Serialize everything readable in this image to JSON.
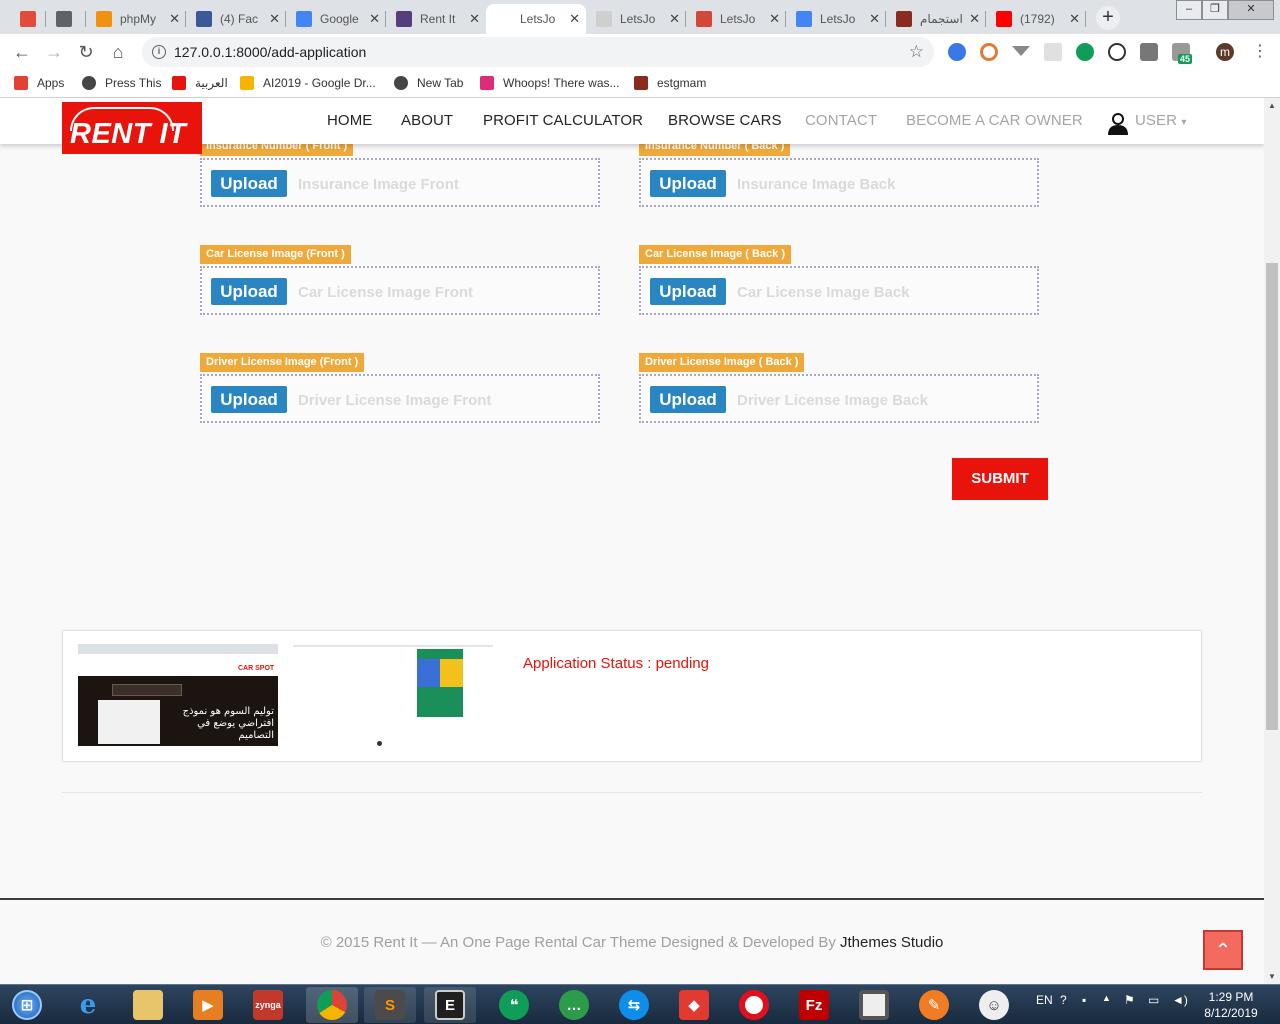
{
  "browser": {
    "tabs": [
      {
        "icon": "u-icon",
        "label": "",
        "color": "#e04b3b"
      },
      {
        "icon": "play-icon",
        "label": "",
        "color": "#5f6368"
      },
      {
        "icon": "pma-icon",
        "label": "phpMy",
        "color": "#f29111"
      },
      {
        "icon": "facebook-icon",
        "label": "(4) Fac",
        "color": "#3b5998"
      },
      {
        "icon": "google-translate-icon",
        "label": "Google",
        "color": "#4285f4"
      },
      {
        "icon": "bootstrap-icon",
        "label": "Rent It",
        "color": "#563d7c"
      },
      {
        "icon": "blank-icon",
        "label": "LetsJo",
        "color": "#ffffff"
      },
      {
        "icon": "doc-icon",
        "label": "LetsJo",
        "color": "#cfcfcf"
      },
      {
        "icon": "gmail-icon",
        "label": "LetsJo",
        "color": "#d44638"
      },
      {
        "icon": "docs-icon",
        "label": "LetsJo",
        "color": "#4285f4"
      },
      {
        "icon": "car-icon",
        "label": "استجمام",
        "color": "#8b2a1e"
      },
      {
        "icon": "youtube-icon",
        "label": "(1792)",
        "color": "#ff0000"
      }
    ],
    "url": "127.0.0.1:8000/add-application",
    "profile_initial": "m",
    "extension_badge": "45",
    "bookmarks": [
      {
        "label": "Apps",
        "icon": "apps-grid-icon",
        "color": "#e44134"
      },
      {
        "label": "Press This",
        "icon": "wordpress-icon",
        "color": "#464646"
      },
      {
        "label": "العربية",
        "icon": "arabic-icon",
        "color": "#e8130b"
      },
      {
        "label": "AI2019 - Google Dr...",
        "icon": "drive-icon",
        "color": "#f4b400"
      },
      {
        "label": "New Tab",
        "icon": "globe-icon",
        "color": "#464646"
      },
      {
        "label": "Whoops! There was...",
        "icon": "whoops-icon",
        "color": "#e02a7a"
      },
      {
        "label": "estgmam",
        "icon": "car-icon",
        "color": "#8b2a1e"
      }
    ]
  },
  "site": {
    "logo": "RENT IT",
    "nav": [
      {
        "label": "HOME",
        "muted": false
      },
      {
        "label": "ABOUT",
        "muted": false
      },
      {
        "label": "PROFIT CALCULATOR",
        "muted": false
      },
      {
        "label": "BROWSE CARS",
        "muted": false
      },
      {
        "label": "CONTACT",
        "muted": true
      },
      {
        "label": "BECOME A CAR OWNER",
        "muted": true
      },
      {
        "label": "USER",
        "muted": true
      }
    ],
    "user_caret": "▾"
  },
  "form": {
    "fields": [
      {
        "label": "Insurance Number ( Front )",
        "button": "Upload",
        "placeholder": "Insurance Image Front"
      },
      {
        "label": "Insurance Number ( Back )",
        "button": "Upload",
        "placeholder": "Insurance Image Back"
      },
      {
        "label": "Car License Image (Front )",
        "button": "Upload",
        "placeholder": "Car License Image Front"
      },
      {
        "label": "Car License Image ( Back )",
        "button": "Upload",
        "placeholder": "Car License Image Back"
      },
      {
        "label": "Driver License Image (Front )",
        "button": "Upload",
        "placeholder": "Driver License Image Front"
      },
      {
        "label": "Driver License Image ( Back )",
        "button": "Upload",
        "placeholder": "Driver License Image Back"
      }
    ],
    "submit": "SUBMIT"
  },
  "application": {
    "status": "Application Status : pending",
    "thumb1_text_line1": "توليم السوم هو نموذج",
    "thumb1_text_line2": "افتراضي يوضع في التصاميم",
    "thumb1_brand": "CAR SPOT"
  },
  "footer": {
    "copyright": "© 2015 Rent It — An One Page Rental Car Theme Designed & Developed By ",
    "studio": "Jthemes Studio",
    "top_arrow": "^"
  },
  "taskbar": {
    "language": "EN",
    "time": "1:29 PM",
    "date": "8/12/2019"
  },
  "colors": {
    "brand_red": "#e8130b",
    "upload_blue": "#2a86c2",
    "badge_orange": "#efa93a"
  }
}
